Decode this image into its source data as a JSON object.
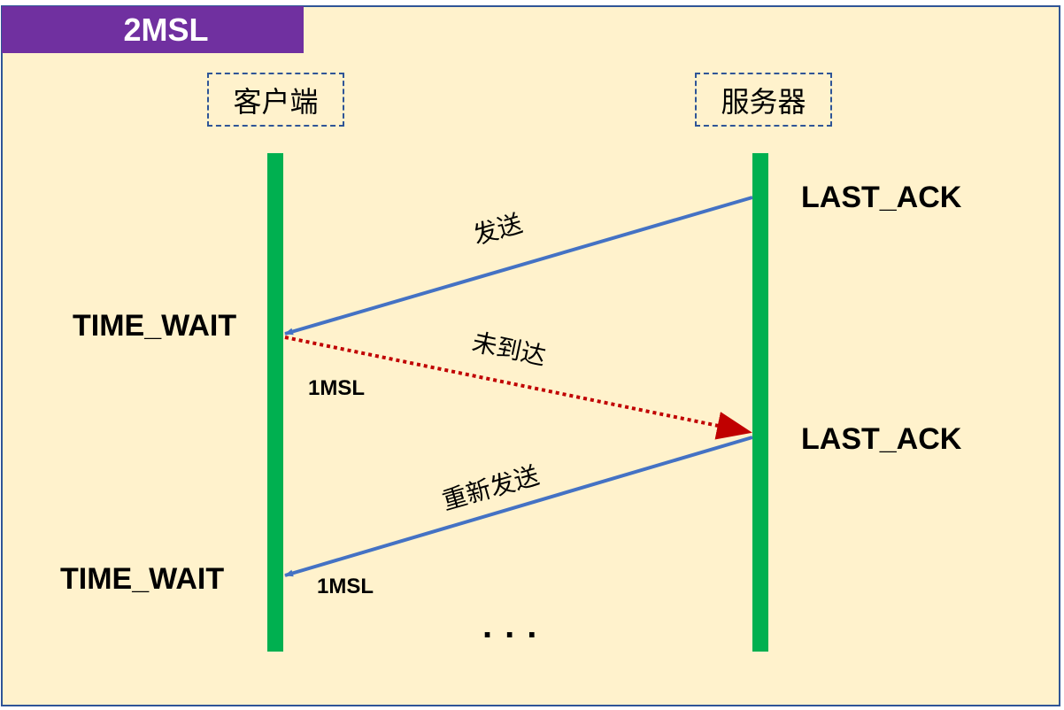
{
  "title": "2MSL",
  "actors": {
    "client": "客户端",
    "server": "服务器"
  },
  "states": {
    "server_1": "LAST_ACK",
    "server_2": "LAST_ACK",
    "client_1": "TIME_WAIT",
    "client_2": "TIME_WAIT"
  },
  "messages": {
    "send": "发送",
    "not_arrived": "未到达",
    "resend": "重新发送"
  },
  "durations": {
    "first": "1MSL",
    "second": "1MSL"
  },
  "ellipsis": "...",
  "colors": {
    "background": "#FFF2CC",
    "banner": "#7030A0",
    "lifeline": "#00B050",
    "arrow": "#4472C4",
    "lost": "#C00000"
  }
}
